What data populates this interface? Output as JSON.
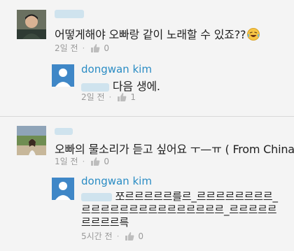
{
  "comments": [
    {
      "text": "어떻게해야 오빠랑 같이 노래할 수 있죠??",
      "emoji": "laughing-crying-emoji",
      "time": "2일 전",
      "likes": "0",
      "reply": {
        "author": "dongwan kim",
        "text": "다음 생에.",
        "time": "2일 전",
        "likes": "1"
      }
    },
    {
      "text": "오빠의 물소리가 듣고 싶어요 ㅜ—ㅠ ( From China )",
      "time": "1일 전",
      "likes": "0",
      "reply": {
        "author": "dongwan kim",
        "text_line1": "쪼르르르르르를르_르르르르르르르르_",
        "text_line2": "르르르르르르르르르르르르르르르_르르르르르",
        "text_line3": "르르르르륵",
        "time": "5시간 전",
        "likes": "0"
      }
    }
  ],
  "colors": {
    "author": "#2a8cc4",
    "background": "#f4f4f4",
    "avatar_default": "#3f87c7"
  }
}
